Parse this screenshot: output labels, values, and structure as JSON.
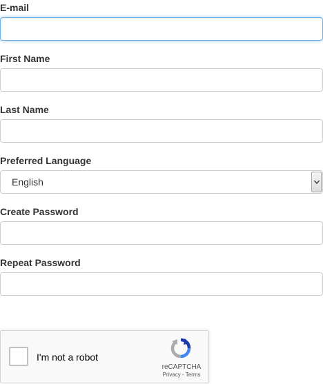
{
  "form": {
    "email": {
      "label": "E-mail",
      "value": "",
      "placeholder": ""
    },
    "first_name": {
      "label": "First Name",
      "value": "",
      "placeholder": ""
    },
    "last_name": {
      "label": "Last Name",
      "value": "",
      "placeholder": ""
    },
    "language": {
      "label": "Preferred Language",
      "selected": "English"
    },
    "password": {
      "label": "Create Password",
      "value": "",
      "placeholder": ""
    },
    "repeat_password": {
      "label": "Repeat Password",
      "value": "",
      "placeholder": ""
    }
  },
  "recaptcha": {
    "label": "I'm not a robot",
    "brand": "reCAPTCHA",
    "privacy": "Privacy",
    "separator": " - ",
    "terms": "Terms",
    "checked": false
  },
  "colors": {
    "focus_border": "#66afe9",
    "input_border": "#cccccc",
    "label_text": "#333333",
    "recaptcha_blue_dark": "#1c3aa9",
    "recaptcha_blue_light": "#4285f4",
    "recaptcha_gray": "#ababab"
  },
  "icons": {
    "select_arrow": "chevron-down-icon",
    "recaptcha_logo": "recaptcha-logo-icon"
  }
}
